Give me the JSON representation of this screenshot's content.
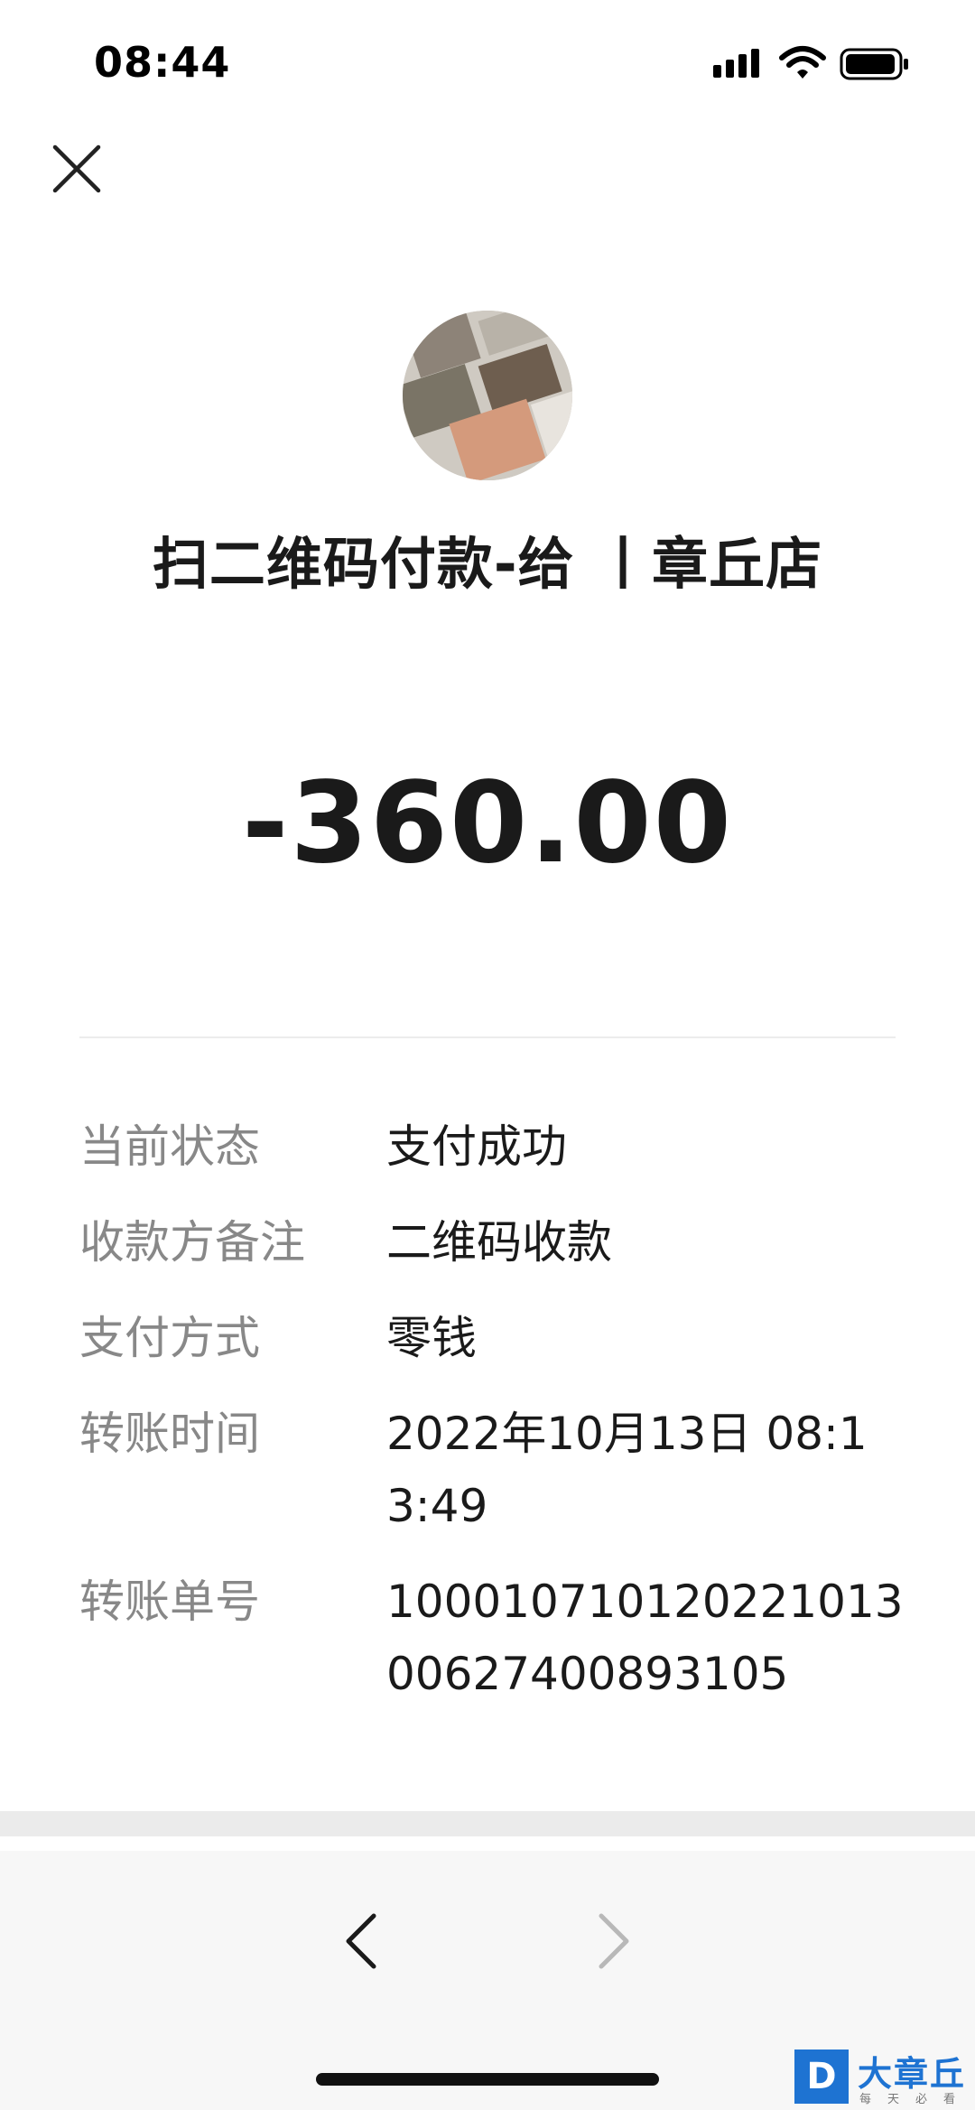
{
  "status_bar": {
    "time": "08:44"
  },
  "header": {
    "title": "扫二维码付款-给 丨章丘店",
    "amount": "-360.00"
  },
  "details": [
    {
      "label": "当前状态",
      "value": "支付成功"
    },
    {
      "label": "收款方备注",
      "value": "二维码收款"
    },
    {
      "label": "支付方式",
      "value": "零钱"
    },
    {
      "label": "转账时间",
      "value": "2022年10月13日 08:13:49"
    },
    {
      "label": "转账单号",
      "value": "100010710120221013006274008931​05"
    }
  ],
  "icons": {
    "close": "close-icon",
    "back": "chevron-left-icon",
    "forward": "chevron-right-icon"
  },
  "watermark": {
    "logo_letter": "D",
    "brand": "大章丘",
    "tagline": "每天必看"
  },
  "colors": {
    "text_primary": "#1a1a1a",
    "text_secondary": "#888888",
    "watermark_blue": "#1e73d2"
  }
}
